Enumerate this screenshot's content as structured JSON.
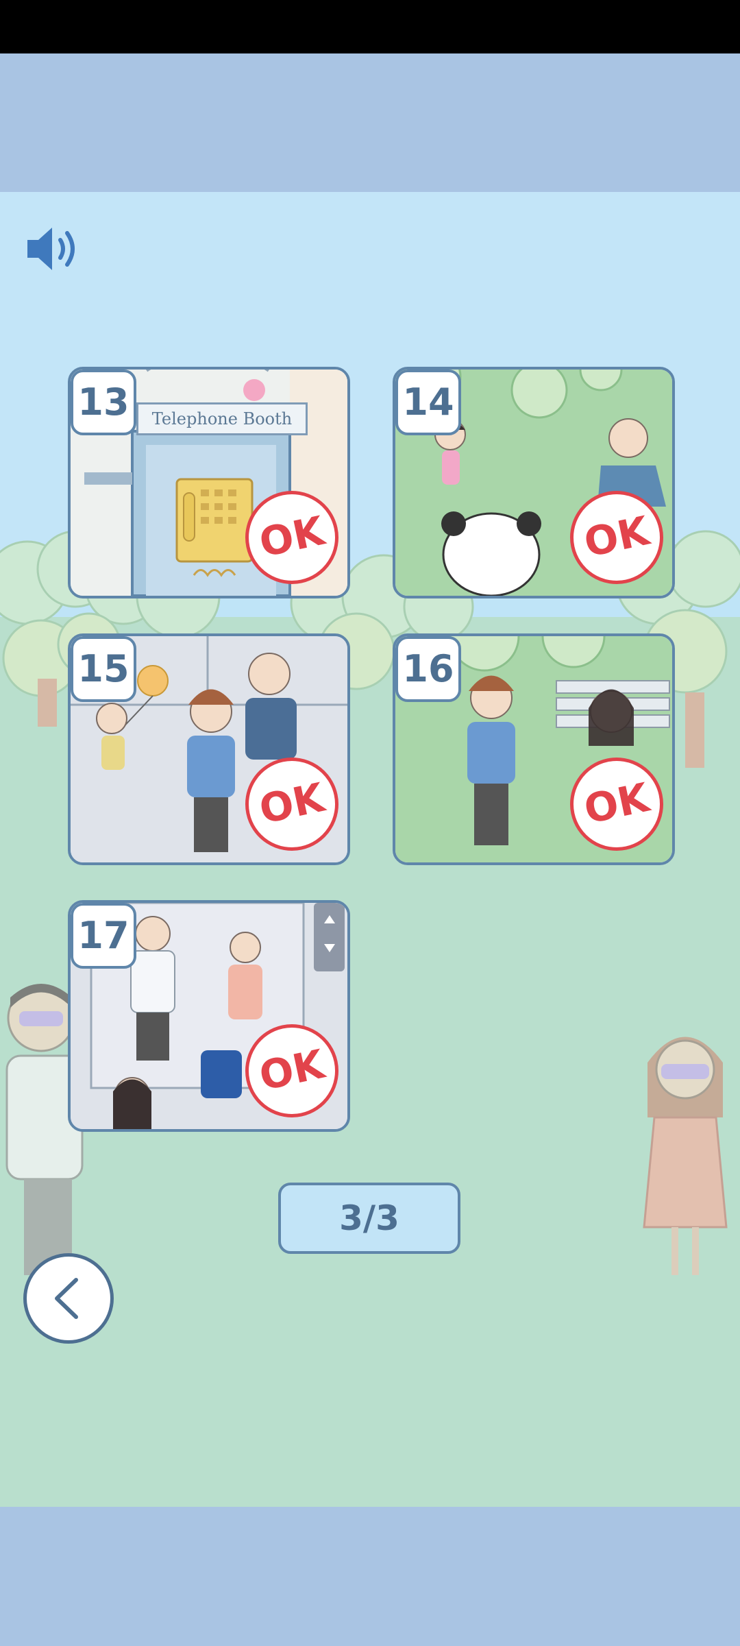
{
  "sound": {
    "icon": "speaker-icon"
  },
  "levels": [
    {
      "number": "13",
      "tag": "Telephone Booth",
      "badge": "OK"
    },
    {
      "number": "14",
      "badge": "OK"
    },
    {
      "number": "15",
      "badge": "OK"
    },
    {
      "number": "16",
      "badge": "OK"
    },
    {
      "number": "17",
      "badge": "OK"
    }
  ],
  "pagination": {
    "current": "3/3"
  },
  "navigation": {
    "back_icon": "chevron-left-icon"
  },
  "colors": {
    "badge_red": "#e2434b",
    "frame_blue": "#5f86aa",
    "band_blue": "#a9c4e3",
    "sky": "#c3e5f8",
    "ground": "#b9dfcd"
  }
}
